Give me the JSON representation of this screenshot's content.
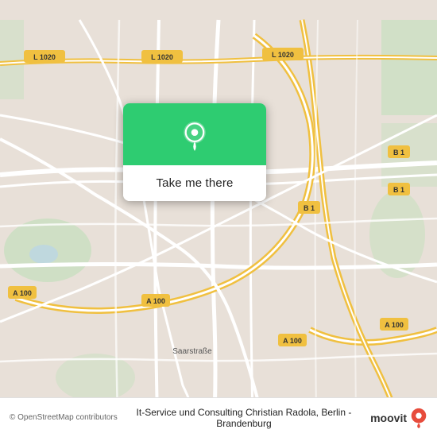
{
  "map": {
    "background_color": "#e8e0d8",
    "road_color_main": "#ffffff",
    "road_color_secondary": "#f5f0e8",
    "highway_color": "#f5d97a",
    "green_area_color": "#c8dfc0"
  },
  "popup": {
    "background_color": "#2ecc71",
    "button_label": "Take me there",
    "pin_icon": "location-pin"
  },
  "bottom_bar": {
    "copyright": "© OpenStreetMap contributors",
    "location_text": "It-Service und Consulting Christian Radola, Berlin - Brandenburg",
    "logo_text": "moovit"
  }
}
